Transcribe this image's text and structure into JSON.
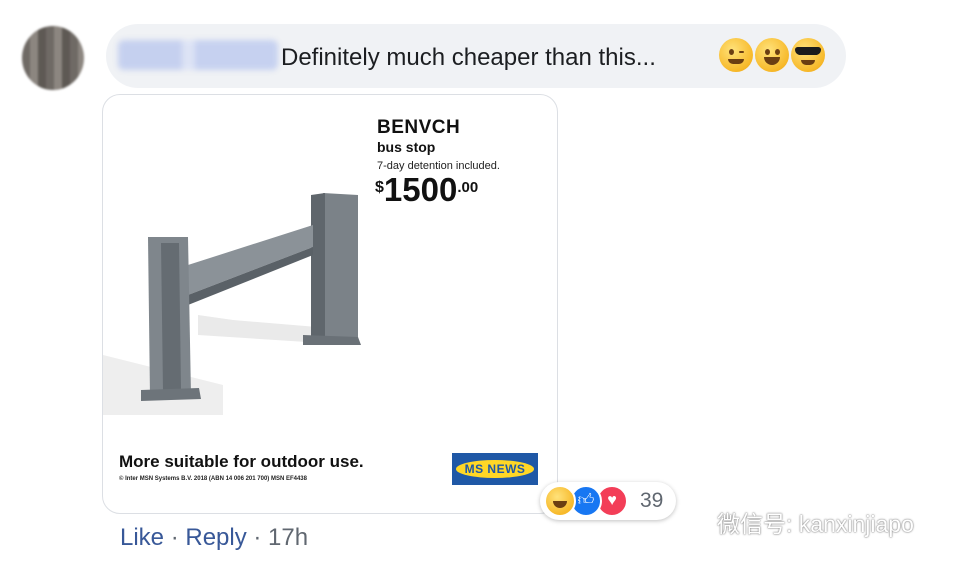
{
  "comment": {
    "text": "Definitely much cheaper than this...",
    "emojis": [
      "winking-face",
      "grinning-face",
      "sunglasses-face"
    ]
  },
  "ad": {
    "product_name": "BENVCH",
    "product_sub": "bus stop",
    "product_note": "7-day detention included.",
    "price_currency": "$",
    "price_main": "1500",
    "price_cents": ".00",
    "tagline": "More suitable for outdoor use.",
    "copyright": "© Inter MSN Systems B.V. 2018 (ABN 14 006 201 700) MSN EF4438",
    "logo_text": "MS NEWS"
  },
  "reactions": {
    "icons": [
      "haha-icon",
      "like-icon",
      "love-icon"
    ],
    "count": "39"
  },
  "actions": {
    "like": "Like",
    "sep1": " · ",
    "reply": "Reply",
    "sep2": " · ",
    "time": "17h"
  },
  "watermark": {
    "text": "微信号: kanxinjiapo"
  },
  "colors": {
    "link": "#385898",
    "bubble": "#f0f2f5",
    "like": "#1877f2",
    "love": "#f33e58"
  }
}
